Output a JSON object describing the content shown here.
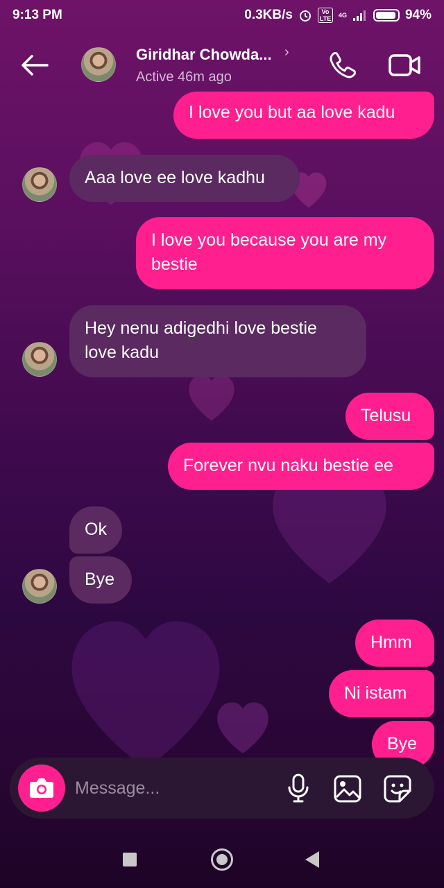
{
  "status_bar": {
    "time": "9:13 PM",
    "network_speed": "0.3KB/s",
    "signal": "4G",
    "volte": "Vo LTE",
    "battery_level": 0.94,
    "battery_text": "94%"
  },
  "header": {
    "contact_name": "Giridhar Chowda...",
    "chevron": "›",
    "contact_status": "Active 46m ago",
    "back_icon": "arrow-left-icon",
    "call_icon": "phone-icon",
    "video_icon": "video-camera-icon"
  },
  "messages": [
    {
      "direction": "sent",
      "text": "I love you but aa love kadu"
    },
    {
      "direction": "received",
      "text": "Aaa love ee love kadhu"
    },
    {
      "direction": "sent",
      "text": "I love you because you are my bestie"
    },
    {
      "direction": "received",
      "text": "Hey nenu adigedhi love bestie love kadu"
    },
    {
      "direction": "sent",
      "text": "Telusu"
    },
    {
      "direction": "sent",
      "text": "Forever nvu naku bestie ee"
    },
    {
      "direction": "received",
      "text": "Ok"
    },
    {
      "direction": "received",
      "text": "Bye"
    },
    {
      "direction": "sent",
      "text": "Hmm"
    },
    {
      "direction": "sent",
      "text": "Ni istam"
    },
    {
      "direction": "sent",
      "text": "Bye"
    }
  ],
  "composer": {
    "placeholder": "Message...",
    "camera_icon": "camera-icon",
    "mic_icon": "microphone-icon",
    "gallery_icon": "image-gallery-icon",
    "sticker_icon": "sticker-icon"
  },
  "colors": {
    "sent_bubble": "#ff1f8e",
    "received_bubble": "#5a2a60",
    "accent": "#ff1f8e"
  }
}
